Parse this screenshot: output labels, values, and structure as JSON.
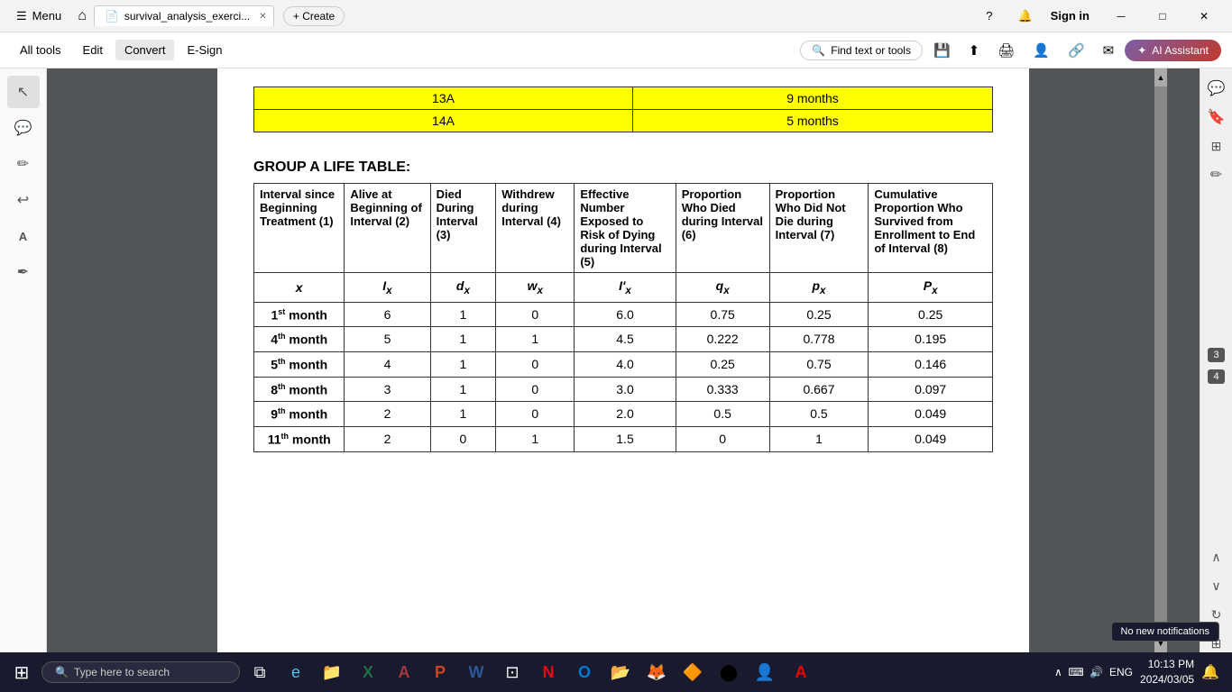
{
  "titlebar": {
    "menu_label": "Menu",
    "home_icon": "⌂",
    "tab_title": "survival_analysis_exerci...",
    "tab_close": "✕",
    "new_tab": "+ Create",
    "help_icon": "?",
    "bell_icon": "🔔",
    "sign_in": "Sign in",
    "minimize": "─",
    "maximize": "□",
    "close": "✕"
  },
  "toolbar": {
    "all_tools": "All tools",
    "edit": "Edit",
    "convert": "Convert",
    "esign": "E-Sign",
    "search_placeholder": "Find text or tools",
    "search_icon": "🔍",
    "save_icon": "💾",
    "upload_icon": "⬆",
    "print_icon": "🖨",
    "user_icon": "👤",
    "link_icon": "🔗",
    "mail_icon": "✉",
    "ai_label": "AI Assistant"
  },
  "sidebar_left": {
    "icons": [
      "↖",
      "💬",
      "✏",
      "↩",
      "A",
      "✒"
    ]
  },
  "top_table": {
    "rows": [
      {
        "col1": "13A",
        "col2": "9 months"
      },
      {
        "col1": "14A",
        "col2": "5 months"
      }
    ]
  },
  "group_title": "GROUP A LIFE TABLE:",
  "life_table": {
    "headers": [
      "Interval since Beginning Treatment (1)",
      "Alive at Beginning of Interval (2)",
      "Died During Interval (3)",
      "Withdrew during Interval (4)",
      "Effective Number Exposed to Risk of Dying during Interval (5)",
      "Proportion Who Died during Interval (6)",
      "Proportion Who Did Not Die during Interval (7)",
      "Cumulative Proportion Who Survived from Enrollment to End of Interval (8)"
    ],
    "symbols": [
      "x",
      "Iₓ",
      "dₓ",
      "wₓ",
      "I'ₓ",
      "qₓ",
      "pₓ",
      "Pₓ"
    ],
    "rows": [
      {
        "interval": "1st month",
        "alive": "6",
        "died": "1",
        "withdrew": "0",
        "effective": "6.0",
        "prop_died": "0.75",
        "prop_not_died": "0.25",
        "cumulative": "0.25"
      },
      {
        "interval": "4th month",
        "alive": "5",
        "died": "1",
        "withdrew": "1",
        "effective": "4.5",
        "prop_died": "0.222",
        "prop_not_died": "0.778",
        "cumulative": "0.195"
      },
      {
        "interval": "5th month",
        "alive": "4",
        "died": "1",
        "withdrew": "0",
        "effective": "4.0",
        "prop_died": "0.25",
        "prop_not_died": "0.75",
        "cumulative": "0.146"
      },
      {
        "interval": "8th month",
        "alive": "3",
        "died": "1",
        "withdrew": "0",
        "effective": "3.0",
        "prop_died": "0.333",
        "prop_not_died": "0.667",
        "cumulative": "0.097"
      },
      {
        "interval": "9th month",
        "alive": "2",
        "died": "1",
        "withdrew": "0",
        "effective": "2.0",
        "prop_died": "0.5",
        "prop_not_died": "0.5",
        "cumulative": "0.049"
      },
      {
        "interval": "11th month",
        "alive": "2",
        "died": "0",
        "withdrew": "1",
        "effective": "1.5",
        "prop_died": "0",
        "prop_not_died": "1",
        "cumulative": "0.049"
      }
    ]
  },
  "right_sidebar": {
    "page_numbers": [
      "3",
      "4"
    ],
    "up_arrow": "∧",
    "down_arrow": "∨",
    "refresh_icon": "↻",
    "chart_icon": "⊞",
    "zoom_icon": "🔍"
  },
  "taskbar": {
    "start_icon": "⊞",
    "search_placeholder": "Type here to search",
    "search_icon": "🔍",
    "task_view": "⧉",
    "edge_icon": "e",
    "file_icon": "📁",
    "excel_icon": "X",
    "access_icon": "A",
    "ppt_icon": "P",
    "word_icon": "W",
    "widgets_icon": "⊡",
    "netflix_icon": "N",
    "outlook_icon": "O",
    "explorer_icon": "📂",
    "firefox_icon": "🦊",
    "vlc_icon": "🔶",
    "chrome_icon": "⬤",
    "user_icon": "👤",
    "acrobat_icon": "A",
    "tray_icons": "∧  ⌨  🔊  ENG",
    "time": "10:13 PM",
    "date": "2024/03/05",
    "notification_icon": "🔔",
    "notification_tooltip": "No new notifications"
  }
}
